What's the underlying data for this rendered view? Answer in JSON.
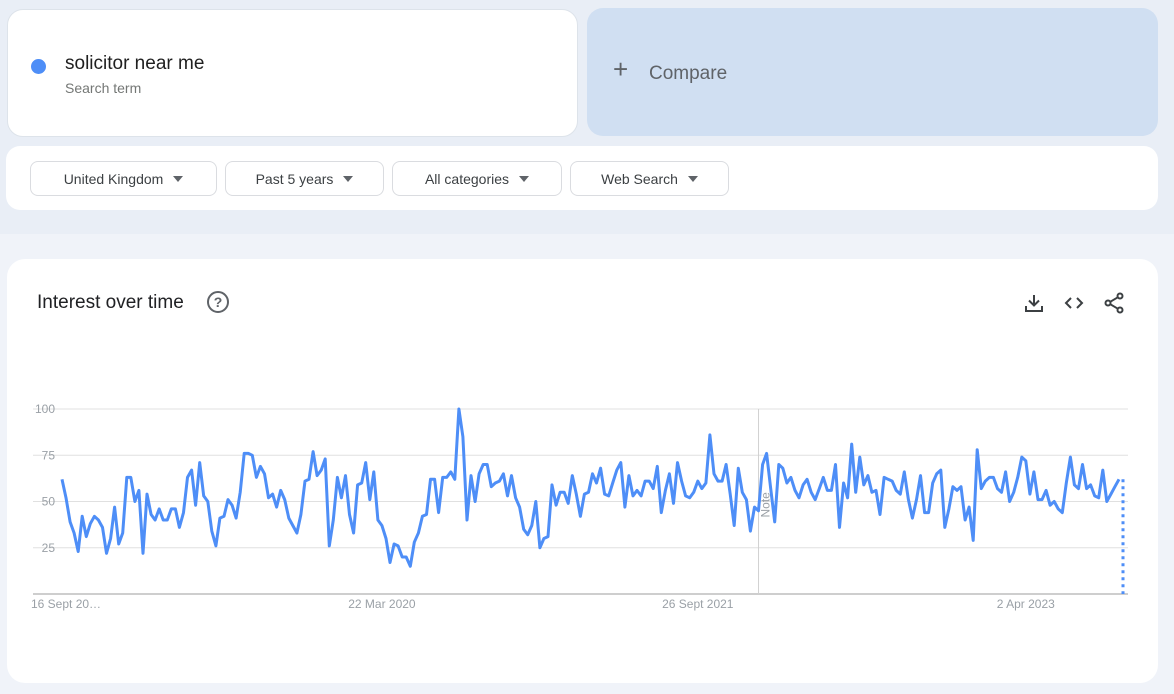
{
  "search_term": {
    "name": "solicitor near me",
    "subtitle": "Search term",
    "color": "#4e8ef7"
  },
  "compare": {
    "label": "Compare",
    "icon": "plus-icon"
  },
  "filters": [
    {
      "label": "United Kingdom",
      "icon": "caret-down-icon"
    },
    {
      "label": "Past 5 years",
      "icon": "caret-down-icon"
    },
    {
      "label": "All categories",
      "icon": "caret-down-icon"
    },
    {
      "label": "Web Search",
      "icon": "caret-down-icon"
    }
  ],
  "panel": {
    "title": "Interest over time",
    "help_icon": "help-icon",
    "tools": [
      "download-icon",
      "embed-code-icon",
      "share-icon"
    ]
  },
  "chart_data": {
    "type": "line",
    "title": "Interest over time",
    "xlabel": "",
    "ylabel": "",
    "ylim": [
      0,
      100
    ],
    "yticks": [
      25,
      50,
      75,
      100
    ],
    "xtick_labels": [
      "16 Sept 20…",
      "22 Mar 2020",
      "26 Sept 2021",
      "2 Apr 2023"
    ],
    "xtick_index": [
      0,
      79,
      157,
      238
    ],
    "grid": true,
    "legend": "none",
    "note_label": "Note",
    "note_index": 172,
    "partial_last_point": true,
    "series": [
      {
        "name": "solicitor near me",
        "color": "#4e8ef7",
        "values": [
          62,
          52,
          39,
          33,
          23,
          42,
          31,
          38,
          42,
          40,
          36,
          22,
          30,
          47,
          27,
          33,
          63,
          63,
          50,
          56,
          22,
          54,
          43,
          40,
          46,
          40,
          40,
          46,
          46,
          36,
          44,
          63,
          67,
          48,
          71,
          53,
          50,
          34,
          26,
          41,
          42,
          51,
          48,
          41,
          55,
          76,
          76,
          75,
          63,
          69,
          65,
          52,
          54,
          47,
          56,
          51,
          41,
          37,
          33,
          43,
          61,
          62,
          77,
          64,
          67,
          73,
          26,
          40,
          63,
          52,
          64,
          43,
          33,
          59,
          60,
          71,
          51,
          66,
          40,
          37,
          30,
          17,
          27,
          26,
          20,
          20,
          15,
          28,
          33,
          42,
          43,
          62,
          62,
          44,
          63,
          63,
          66,
          62,
          100,
          85,
          40,
          64,
          50,
          65,
          70,
          70,
          58,
          60,
          61,
          65,
          53,
          64,
          52,
          47,
          35,
          32,
          37,
          50,
          25,
          30,
          31,
          59,
          48,
          55,
          55,
          49,
          64,
          54,
          42,
          54,
          55,
          65,
          60,
          68,
          54,
          53,
          60,
          67,
          71,
          47,
          64,
          53,
          56,
          53,
          61,
          61,
          57,
          69,
          44,
          56,
          65,
          49,
          71,
          61,
          53,
          52,
          55,
          61,
          57,
          60,
          86,
          65,
          61,
          61,
          70,
          54,
          37,
          68,
          55,
          51,
          34,
          47,
          45,
          70,
          76,
          57,
          39,
          70,
          68,
          60,
          63,
          56,
          52,
          59,
          62,
          55,
          51,
          57,
          63,
          56,
          56,
          70,
          36,
          60,
          52,
          81,
          55,
          74,
          59,
          64,
          55,
          56,
          43,
          63,
          62,
          61,
          56,
          54,
          66,
          51,
          41,
          51,
          64,
          44,
          44,
          60,
          65,
          67,
          36,
          46,
          58,
          56,
          58,
          40,
          47,
          29,
          78,
          57,
          61,
          63,
          63,
          57,
          55,
          66,
          50,
          55,
          63,
          74,
          72,
          54,
          66,
          51,
          51,
          56,
          48,
          50,
          46,
          44,
          60,
          74,
          59,
          57,
          70,
          57,
          59,
          53,
          52,
          67,
          50,
          54,
          58,
          62,
          62
        ]
      }
    ]
  }
}
